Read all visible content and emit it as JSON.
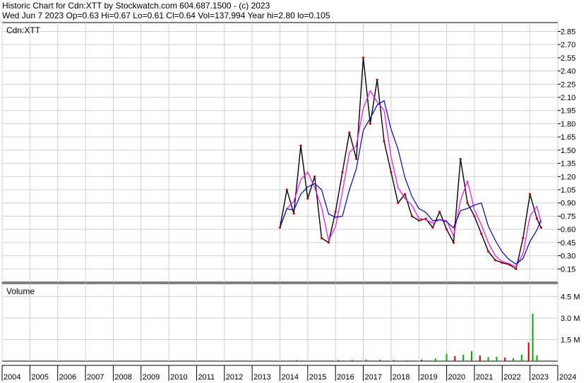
{
  "header": {
    "line1": "Historic Chart for Cdn:XTT by Stockwatch.com 604.687.1500 - (c) 2023",
    "line2": "Wed Jun  7 2023   Op=0.63  Hi=0.67  Lo=0.61  Cl=0.64  Vol=137,994  Year hi=2.80  lo=0.105"
  },
  "colors": {
    "price": "#000000",
    "close_tick": "#cc0000",
    "ma_short": "#ff00ff",
    "ma_long": "#0000cc",
    "volume_up": "#00aa00",
    "volume_down": "#cc0000",
    "grid": "#d0d0d0"
  },
  "chart_data": [
    {
      "type": "line",
      "title": "Cdn:XTT",
      "ylim": [
        0,
        2.95
      ],
      "yticks": [
        "0.15",
        "0.30",
        "0.45",
        "0.60",
        "0.75",
        "0.90",
        "1.05",
        "1.20",
        "1.35",
        "1.50",
        "1.65",
        "1.80",
        "1.95",
        "2.10",
        "2.25",
        "2.40",
        "2.55",
        "2.70",
        "2.85"
      ],
      "grid": true,
      "x": [
        2014.0,
        2014.25,
        2014.5,
        2014.75,
        2015.0,
        2015.25,
        2015.5,
        2015.75,
        2016.0,
        2016.25,
        2016.5,
        2016.75,
        2017.0,
        2017.25,
        2017.5,
        2017.75,
        2018.0,
        2018.25,
        2018.5,
        2018.75,
        2019.0,
        2019.25,
        2019.5,
        2019.75,
        2020.0,
        2020.25,
        2020.5,
        2020.75,
        2021.0,
        2021.25,
        2021.5,
        2021.75,
        2022.0,
        2022.25,
        2022.5,
        2022.75,
        2023.0,
        2023.25,
        2023.4
      ],
      "series": [
        {
          "values": [
            0.62,
            1.05,
            0.78,
            1.55,
            0.95,
            1.2,
            0.5,
            0.45,
            0.8,
            1.25,
            1.7,
            1.4,
            2.55,
            1.8,
            2.3,
            1.6,
            1.25,
            0.9,
            1.0,
            0.75,
            0.7,
            0.72,
            0.62,
            0.8,
            0.6,
            0.45,
            1.4,
            0.9,
            0.75,
            0.55,
            0.35,
            0.25,
            0.22,
            0.2,
            0.15,
            0.5,
            1.0,
            0.72,
            0.62
          ]
        }
      ]
    },
    {
      "type": "bar",
      "title": "Volume",
      "ylim": [
        0,
        5.4
      ],
      "yticks": [
        "1.5 M",
        "3.0 M",
        "4.5 M"
      ],
      "grid": true,
      "x": [
        2014.1,
        2014.6,
        2015.1,
        2015.6,
        2016.1,
        2016.6,
        2017.1,
        2017.6,
        2018.1,
        2018.6,
        2019.1,
        2019.6,
        2020.0,
        2020.3,
        2020.6,
        2020.9,
        2021.2,
        2021.5,
        2021.8,
        2022.1,
        2022.4,
        2022.7,
        2022.95,
        2023.1,
        2023.25
      ],
      "values": [
        0.05,
        0.06,
        0.04,
        0.05,
        0.07,
        0.09,
        0.11,
        0.08,
        0.09,
        0.06,
        0.1,
        0.18,
        0.5,
        0.35,
        0.45,
        0.7,
        0.4,
        0.28,
        0.3,
        0.25,
        0.2,
        0.45,
        1.3,
        3.3,
        0.4
      ]
    }
  ],
  "x_axis": {
    "years": [
      "2004",
      "2005",
      "2006",
      "2007",
      "2008",
      "2009",
      "2010",
      "2011",
      "2012",
      "2013",
      "2014",
      "2015",
      "2016",
      "2017",
      "2018",
      "2019",
      "2020",
      "2021",
      "2022",
      "2023",
      "2024"
    ],
    "range": [
      2004,
      2024
    ]
  }
}
